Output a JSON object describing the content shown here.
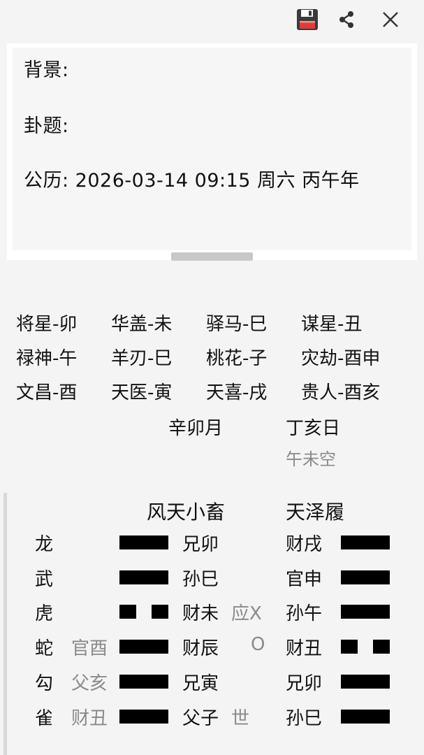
{
  "toolbar": {
    "save_icon": "save-icon",
    "share_icon": "share-icon",
    "close_icon": "close-icon"
  },
  "info": {
    "background_label": "背景:",
    "topic_label": "卦题:",
    "calendar_line": "公历: 2026-03-14  09:15  周六 丙午年"
  },
  "shensha": [
    [
      "将星-卯",
      "华盖-未",
      "驿马-巳",
      "谋星-丑"
    ],
    [
      "禄神-午",
      "羊刃-巳",
      "桃花-子",
      "灾劫-酉申"
    ],
    [
      "文昌-酉",
      "天医-寅",
      "天喜-戌",
      "贵人-酉亥"
    ]
  ],
  "date": {
    "month": "辛卯月",
    "day": "丁亥日",
    "kong": "午未空"
  },
  "gua": {
    "main_name": "风天小畜",
    "changed_name": "天泽履",
    "rows": [
      {
        "god": "龙",
        "fushen": "",
        "main_yao": "yang",
        "main_text": "兄卯",
        "marker": "",
        "changed_text": "财戌",
        "changed_yao": "yang"
      },
      {
        "god": "武",
        "fushen": "",
        "main_yao": "yang",
        "main_text": "孙巳",
        "marker": "",
        "changed_text": "官申",
        "changed_yao": "yang"
      },
      {
        "god": "虎",
        "fushen": "",
        "main_yao": "yin",
        "main_text": "财未",
        "marker": "应X",
        "changed_text": "孙午",
        "changed_yao": "yang"
      },
      {
        "god": "蛇",
        "fushen": "官酉",
        "main_yao": "yang",
        "main_text": "财辰",
        "marker": "O",
        "changed_text": "财丑",
        "changed_yao": "yin"
      },
      {
        "god": "勾",
        "fushen": "父亥",
        "main_yao": "yang",
        "main_text": "兄寅",
        "marker": "",
        "changed_text": "兄卯",
        "changed_yao": "yang"
      },
      {
        "god": "雀",
        "fushen": "财丑",
        "main_yao": "yang",
        "main_text": "父子",
        "marker": "世",
        "changed_text": "孙巳",
        "changed_yao": "yang"
      }
    ]
  }
}
